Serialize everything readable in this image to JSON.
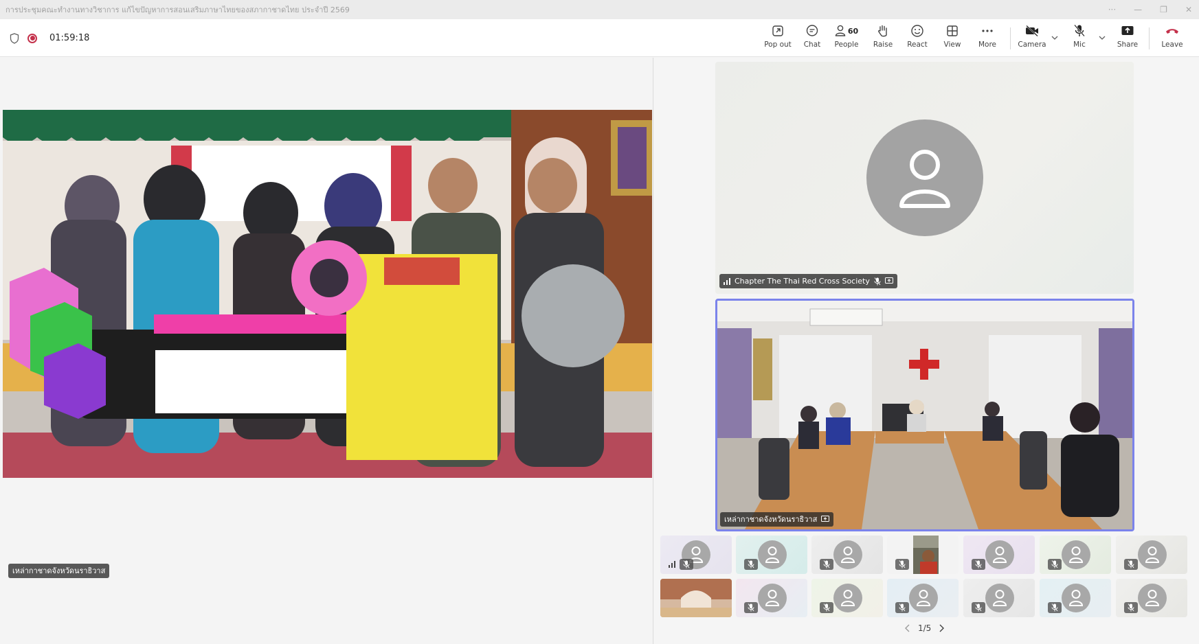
{
  "window": {
    "title": "การประชุมคณะทำงานทางวิชาการ แก้ไขปัญหาการสอนเสริมภาษาไทยของสภากาชาดไทย ประจำปี 2569"
  },
  "toolbar": {
    "timer": "01:59:18",
    "buttons": {
      "popout": "Pop out",
      "chat": "Chat",
      "people": "People",
      "people_count": "60",
      "raise": "Raise",
      "react": "React",
      "view": "View",
      "more": "More",
      "camera": "Camera",
      "mic": "Mic",
      "share": "Share",
      "leave": "Leave"
    }
  },
  "stage": {
    "main_name": "เหล่ากาชาดจังหวัดนราธิวาส",
    "tile1_name": "Chapter The Thai Red Cross Society",
    "tile2_name": "เหล่ากาชาดจังหวัดนราธิวาส",
    "pager": "1/5"
  },
  "colors": {
    "active_border": "#7b83eb",
    "leave": "#c4314b",
    "record": "#c4314b"
  }
}
